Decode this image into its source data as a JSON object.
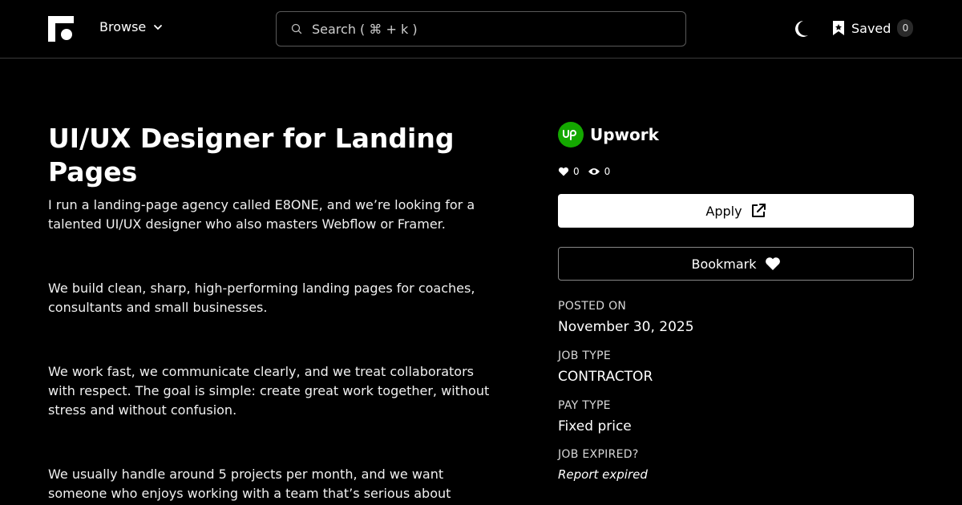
{
  "header": {
    "browse_label": "Browse",
    "search_placeholder": "Search ( ⌘ + k )",
    "saved_label": "Saved",
    "saved_count": "0"
  },
  "job": {
    "title": "UI/UX Designer for Landing Pages",
    "paragraphs": [
      "I run a landing-page agency called E8ONE, and we’re looking for a talented UI/UX designer who also masters Webflow or Framer.",
      "We build clean, sharp, high-performing landing pages for coaches, consultants and small businesses.",
      "We work fast, we communicate clearly, and we treat collaborators with respect. The goal is simple: create great work together, without stress and without confusion.",
      "We usually handle around 5 projects per month, and we want someone who enjoys working with a team that’s serious about"
    ]
  },
  "sidebar": {
    "company": "Upwork",
    "likes": "0",
    "views": "0",
    "apply_label": "Apply",
    "bookmark_label": "Bookmark",
    "posted_on_label": "POSTED ON",
    "posted_on_value": "November 30, 2025",
    "job_type_label": "JOB TYPE",
    "job_type_value": "CONTRACTOR",
    "pay_type_label": "PAY TYPE",
    "pay_type_value": "Fixed price",
    "expired_label": "JOB EXPIRED?",
    "report_label": "Report expired"
  },
  "colors": {
    "background": "#000000",
    "upwork_green": "#14a800"
  }
}
